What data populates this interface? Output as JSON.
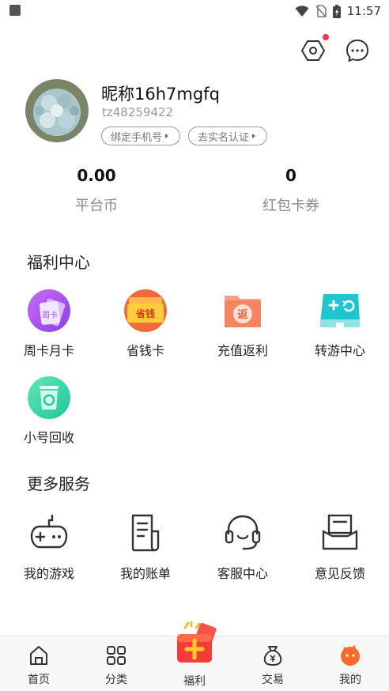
{
  "status_bar": {
    "time": "11:57"
  },
  "header": {
    "settings_icon": "settings-hex-icon",
    "message_icon": "chat-bubble-icon",
    "has_notification": true
  },
  "profile": {
    "nickname": "昵称16h7mgfq",
    "user_id": "tz48259422",
    "bind_phone_label": "绑定手机号",
    "real_name_label": "去实名认证"
  },
  "stats": [
    {
      "value": "0.00",
      "label": "平台币"
    },
    {
      "value": "0",
      "label": "红包卡券"
    }
  ],
  "welfare": {
    "title": "福利中心",
    "items": [
      {
        "label": "周卡月卡",
        "icon": "weekly-monthly-card-icon",
        "badge_text": "周卡"
      },
      {
        "label": "省钱卡",
        "icon": "saving-card-icon",
        "badge_text": "省钱"
      },
      {
        "label": "充值返利",
        "icon": "recharge-rebate-icon",
        "badge_text": "返"
      },
      {
        "label": "转游中心",
        "icon": "game-transfer-icon"
      },
      {
        "label": "小号回收",
        "icon": "account-recycle-icon"
      }
    ]
  },
  "services": {
    "title": "更多服务",
    "items": [
      {
        "label": "我的游戏",
        "icon": "gamepad-icon"
      },
      {
        "label": "我的账单",
        "icon": "bill-icon"
      },
      {
        "label": "客服中心",
        "icon": "headset-icon"
      },
      {
        "label": "意见反馈",
        "icon": "feedback-inbox-icon"
      }
    ]
  },
  "bottom_nav": {
    "items": [
      {
        "label": "首页",
        "icon": "home-icon"
      },
      {
        "label": "分类",
        "icon": "category-grid-icon"
      },
      {
        "label": "福利",
        "icon": "gift-box-icon"
      },
      {
        "label": "交易",
        "icon": "money-bag-icon"
      },
      {
        "label": "我的",
        "icon": "profile-orange-icon",
        "active": true
      }
    ]
  },
  "colors": {
    "accent": "#f56c2b",
    "notification": "#f0384a",
    "text_primary": "#222222",
    "text_secondary": "#888888"
  }
}
